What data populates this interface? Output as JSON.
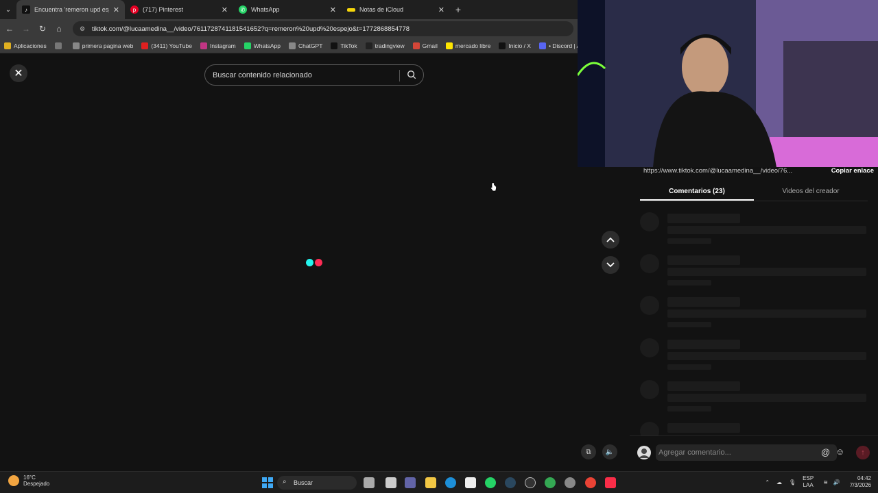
{
  "browser": {
    "tabs": [
      {
        "title": "Encuentra 'remeron upd espejo'",
        "active": true,
        "icon": "tiktok-icon"
      },
      {
        "title": "(717) Pinterest",
        "active": false,
        "icon": "pinterest-icon"
      },
      {
        "title": "WhatsApp",
        "active": false,
        "icon": "whatsapp-icon"
      },
      {
        "title": "Notas de iCloud",
        "active": false,
        "icon": "notes-icon"
      }
    ],
    "url": "tiktok.com/@lucaamedina__/video/7611728741181541652?q=remeron%20upd%20espejo&t=1772868854778",
    "bookmarks": [
      {
        "label": "Aplicaciones",
        "color": "#e0b020"
      },
      {
        "label": "",
        "color": "#777777"
      },
      {
        "label": "primera pagina web",
        "color": "#888888"
      },
      {
        "label": "(3411) YouTube",
        "color": "#e02020"
      },
      {
        "label": "Instagram",
        "color": "#c13584"
      },
      {
        "label": "WhatsApp",
        "color": "#25d366"
      },
      {
        "label": "ChatGPT",
        "color": "#888888"
      },
      {
        "label": "TikTok",
        "color": "#111111"
      },
      {
        "label": "tradingview",
        "color": "#222222"
      },
      {
        "label": "Gmail",
        "color": "#d44638"
      },
      {
        "label": "mercado libre",
        "color": "#ffe600"
      },
      {
        "label": "Inicio / X",
        "color": "#111111"
      },
      {
        "label": "• Discord | Amigos",
        "color": "#5865f2"
      }
    ]
  },
  "page": {
    "search_placeholder": "Buscar contenido relacionado"
  },
  "panel": {
    "link_text": "https://www.tiktok.com/@lucaamedina__/video/76...",
    "copy_label": "Copiar enlace",
    "tab_comments": "Comentarios (23)",
    "tab_creator": "Videos del creador",
    "comment_placeholder": "Agregar comentario..."
  },
  "taskbar": {
    "temp": "16°C",
    "weather": "Despejado",
    "search_label": "Buscar",
    "lang": "ESP",
    "layout": "LAA",
    "time": "04:42",
    "date": "7/3/2026"
  }
}
